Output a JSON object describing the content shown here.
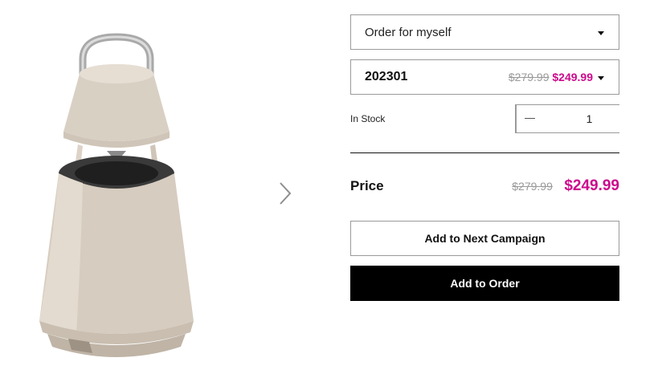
{
  "purchase_option": {
    "selected": "Order for myself"
  },
  "sku_selector": {
    "code": "202301",
    "original_price": "$279.99",
    "sale_price": "$249.99"
  },
  "stock": {
    "status": "In Stock"
  },
  "quantity": {
    "value": "1"
  },
  "price": {
    "label": "Price",
    "original": "$279.99",
    "sale": "$249.99"
  },
  "actions": {
    "add_next_campaign": "Add to Next Campaign",
    "add_order": "Add to Order"
  },
  "colors": {
    "sale": "#cc0a8c",
    "primary_button": "#000000",
    "border": "#9a9a9a"
  },
  "icons": {
    "next": "chevron-right-icon",
    "dropdown": "caret-down-icon",
    "minus": "minus-icon",
    "plus": "plus-icon"
  }
}
